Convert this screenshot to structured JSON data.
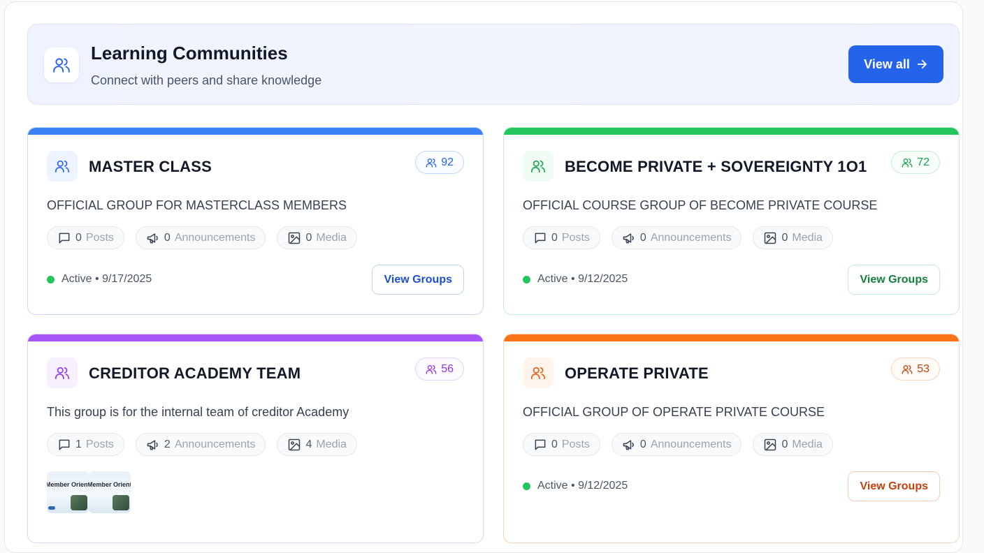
{
  "header": {
    "title": "Learning Communities",
    "subtitle": "Connect with peers and share knowledge",
    "view_all_label": "View all",
    "icon": "users-icon"
  },
  "colors": {
    "primary": "#2563eb",
    "blue": "#3b82f6",
    "green": "#22c55e",
    "purple": "#a855f7",
    "orange": "#f97316",
    "active_dot": "#22c55e"
  },
  "cards": [
    {
      "title": "MASTER CLASS",
      "count": "92",
      "description": "OFFICIAL GROUP FOR MASTERCLASS MEMBERS",
      "posts_num": "0",
      "posts_label": "Posts",
      "ann_num": "0",
      "ann_label": "Announcements",
      "media_num": "0",
      "media_label": "Media",
      "status": "Active • 9/17/2025",
      "button": "View Groups"
    },
    {
      "title": "BECOME PRIVATE + SOVEREIGNTY 1O1",
      "count": "72",
      "description": "OFFICIAL COURSE GROUP OF BECOME PRIVATE COURSE",
      "posts_num": "0",
      "posts_label": "Posts",
      "ann_num": "0",
      "ann_label": "Announcements",
      "media_num": "0",
      "media_label": "Media",
      "status": "Active • 9/12/2025",
      "button": "View Groups"
    },
    {
      "title": "CREDITOR ACADEMY TEAM",
      "count": "56",
      "description": "This group is for the internal team of creditor Academy",
      "posts_num": "1",
      "posts_label": "Posts",
      "ann_num": "2",
      "ann_label": "Announcements",
      "media_num": "4",
      "media_label": "Media",
      "thumb_text": "Member Orientation"
    },
    {
      "title": "OPERATE PRIVATE",
      "count": "53",
      "description": "OFFICIAL GROUP OF OPERATE PRIVATE COURSE",
      "posts_num": "0",
      "posts_label": "Posts",
      "ann_num": "0",
      "ann_label": "Announcements",
      "media_num": "0",
      "media_label": "Media",
      "status": "Active • 9/12/2025",
      "button": "View Groups"
    }
  ]
}
